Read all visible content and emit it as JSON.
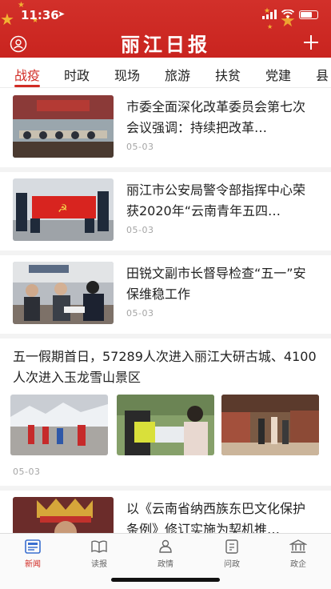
{
  "status": {
    "time": "11:36"
  },
  "header": {
    "title": "丽江日报"
  },
  "tabs": [
    "战疫",
    "时政",
    "现场",
    "旅游",
    "扶贫",
    "党建",
    "县"
  ],
  "articles": [
    {
      "title": "市委全面深化改革委员会第七次会议强调：持续把改革…",
      "date": "05-03"
    },
    {
      "title": "丽江市公安局警令部指挥中心荣获2020年“云南青年五四…",
      "date": "05-03"
    },
    {
      "title": "田锐文副市长督导检查“五一”安保维稳工作",
      "date": "05-03"
    },
    {
      "title": "五一假期首日，57289人次进入丽江大研古城、4100人次进入玉龙雪山景区",
      "date": "05-03"
    },
    {
      "title": "以《云南省纳西族东巴文化保护条例》修订实施为契机推…",
      "date": ""
    }
  ],
  "tabbar": [
    "新闻",
    "读报",
    "政情",
    "问政",
    "政企"
  ],
  "colors": {
    "brand_red": "#d12b24",
    "header_red": "#cc2a24",
    "star_gold": "#f2b233"
  }
}
